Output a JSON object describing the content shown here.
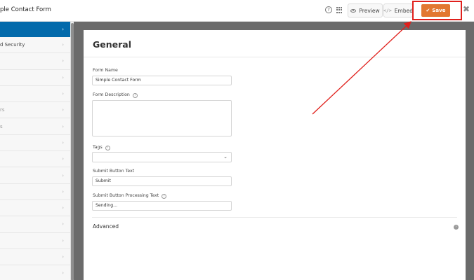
{
  "header": {
    "title": "ple Contact Form",
    "help_glyph": "?",
    "preview_label": "Preview",
    "embed_label": "Embed",
    "embed_glyph": "</>",
    "save_label": "Save",
    "save_glyph": "✔",
    "close_glyph": "✖",
    "accent_color": "#e27730",
    "highlight_color": "#e0201c"
  },
  "sidebar": {
    "active_color": "#036aab",
    "items": [
      {
        "label": "",
        "active": true
      },
      {
        "label": "d Security"
      },
      {
        "label": ""
      },
      {
        "label": ""
      },
      {
        "label": ""
      },
      {
        "label": "rs",
        "muted": true
      },
      {
        "label": "s",
        "muted": true
      },
      {
        "label": ""
      },
      {
        "label": ""
      },
      {
        "label": ""
      },
      {
        "label": ""
      },
      {
        "label": ""
      },
      {
        "label": ""
      },
      {
        "label": ""
      },
      {
        "label": ""
      },
      {
        "label": ""
      }
    ],
    "chevron": "›"
  },
  "main": {
    "heading": "General",
    "fields": {
      "form_name_label": "Form Name",
      "form_name_value": "Simple Contact Form",
      "form_description_label": "Form Description",
      "form_description_value": "",
      "tags_label": "Tags",
      "tags_value": "",
      "submit_text_label": "Submit Button Text",
      "submit_text_value": "Submit",
      "processing_text_label": "Submit Button Processing Text",
      "processing_text_value": "Sending..."
    },
    "help_glyph": "?",
    "advanced_label": "Advanced",
    "advanced_glyph": "›"
  }
}
